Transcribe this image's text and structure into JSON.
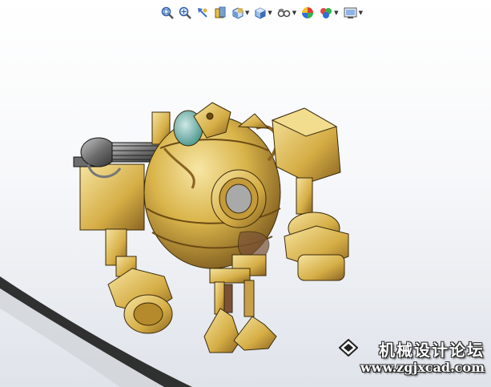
{
  "viewport": {
    "background_top": "#ffffff",
    "background_bottom": "#dfe3ea",
    "model_color": "#d9b44a"
  },
  "toolbar": {
    "items": [
      {
        "icon": "zoom-to-fit-icon",
        "has_dropdown": false
      },
      {
        "icon": "zoom-to-area-icon",
        "has_dropdown": false
      },
      {
        "icon": "previous-view-icon",
        "has_dropdown": false
      },
      {
        "icon": "section-view-icon",
        "has_dropdown": false
      },
      {
        "icon": "view-orientation-icon",
        "has_dropdown": true
      },
      {
        "icon": "display-style-icon",
        "has_dropdown": true
      },
      {
        "icon": "hide-show-items-icon",
        "has_dropdown": true
      },
      {
        "icon": "edit-appearance-icon",
        "has_dropdown": false
      },
      {
        "icon": "apply-scene-icon",
        "has_dropdown": true
      },
      {
        "icon": "view-settings-icon",
        "has_dropdown": true
      }
    ]
  },
  "watermark": {
    "title": "机械设计论坛",
    "url": "www.zgjxcad.com"
  }
}
